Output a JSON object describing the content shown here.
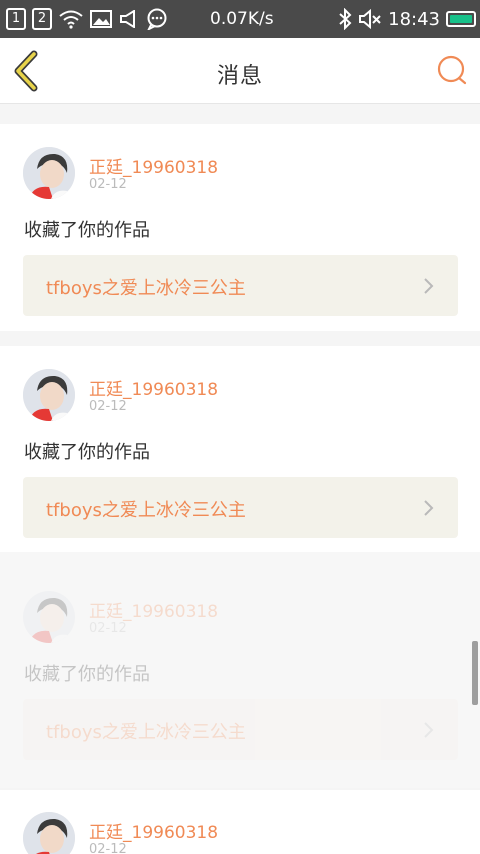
{
  "status_bar": {
    "sim1": "1",
    "sim2": "2",
    "network_speed": "0.07K/s",
    "time": "18:43",
    "icons": [
      "sim-1-icon",
      "sim-2-icon",
      "wifi-icon",
      "image-icon",
      "speaker-icon",
      "chat-icon",
      "bluetooth-icon",
      "mute-icon",
      "battery-icon"
    ],
    "battery_color": "#18c18a"
  },
  "header": {
    "title": "消息",
    "back_icon": "chevron-left-icon",
    "search_icon": "search-icon",
    "accent_color": "#f08a55"
  },
  "messages": [
    {
      "username": "正廷_19960318",
      "date": "02-12",
      "action": "收藏了你的作品",
      "work_title": "tfboys之爱上冰冷三公主"
    },
    {
      "username": "正廷_19960318",
      "date": "02-12",
      "action": "收藏了你的作品",
      "work_title": "tfboys之爱上冰冷三公主"
    },
    {
      "username": "正廷_19960318",
      "date": "02-12",
      "action": "收藏了你的作品",
      "work_title": "tfboys之爱上冰冷三公主"
    },
    {
      "username": "正廷_19960318",
      "date": "02-12",
      "action": "",
      "work_title": ""
    }
  ]
}
